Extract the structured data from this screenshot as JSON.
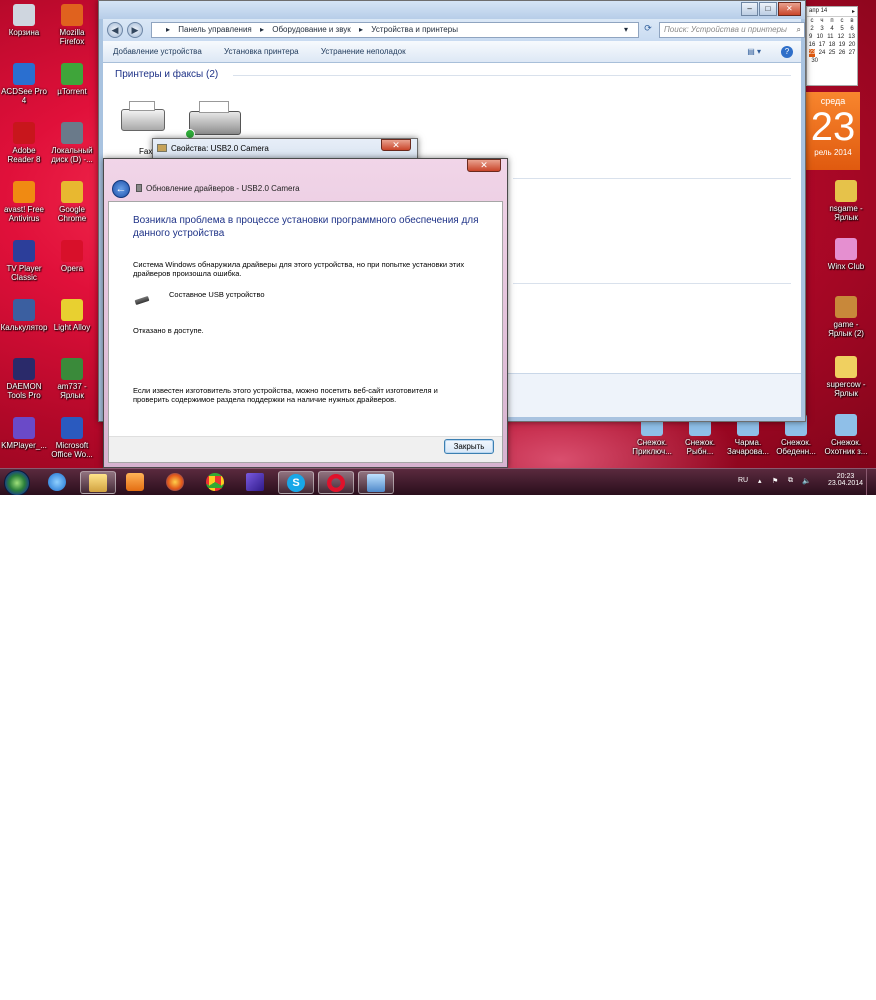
{
  "desktop_left": [
    {
      "label": "Корзина"
    },
    {
      "label": "Mozilla Firefox"
    },
    {
      "label": "ACDSee Pro 4"
    },
    {
      "label": "µTorrent"
    },
    {
      "label": "Adobe Reader 8"
    },
    {
      "label": "Локальный диск (D) -..."
    },
    {
      "label": "avast! Free Antivirus"
    },
    {
      "label": "Google Chrome"
    },
    {
      "label": "TV Player Classic"
    },
    {
      "label": "Opera"
    },
    {
      "label": "Калькулятор"
    },
    {
      "label": "Light Alloy"
    },
    {
      "label": "DAEMON Tools Pro"
    },
    {
      "label": "am737 - Ярлык"
    },
    {
      "label": "KMPlayer_..."
    },
    {
      "label": "Microsoft Office Wo..."
    }
  ],
  "desktop_right": [
    {
      "label": "nsgame - Ярлык"
    },
    {
      "label": "Winx Club"
    },
    {
      "label": "game - Ярлык (2)"
    },
    {
      "label": "supercow - Ярлык"
    },
    {
      "label": "Снежок. Охотник з..."
    }
  ],
  "desktop_bottom": [
    {
      "label": "Снежок. Приключ..."
    },
    {
      "label": "Снежок. Рыбн..."
    },
    {
      "label": "Чарма. Зачарова..."
    },
    {
      "label": "Снежок. Обеденн..."
    }
  ],
  "control_panel": {
    "breadcrumb": [
      "Панель управления",
      "Оборудование и звук",
      "Устройства и принтеры"
    ],
    "search_placeholder": "Поиск: Устройства и принтеры",
    "toolbar": [
      "Добавление устройства",
      "Установка принтера",
      "Устранение неполадок"
    ],
    "group_title": "Принтеры и факсы (2)",
    "fax_label": "Fax"
  },
  "properties_window": {
    "title": "Свойства: USB2.0 Camera"
  },
  "dialog": {
    "title": "Обновление драйверов - USB2.0 Camera",
    "heading": "Возникла проблема в процессе установки программного обеспечения для данного устройства",
    "message": "Система Windows обнаружила драйверы для этого устройства, но при попытке установки этих драйверов произошла ошибка.",
    "device": "Составное USB устройство",
    "error": "Отказано в доступе.",
    "hint": "Если известен изготовитель этого устройства, можно посетить веб-сайт изготовителя и проверить содержимое раздела поддержки на наличие нужных драйверов.",
    "close_label": "Закрыть"
  },
  "calendar": {
    "month": "апр 14",
    "days_header": [
      "с",
      "ч",
      "п",
      "с",
      "в"
    ],
    "rows": [
      [
        "2",
        "3",
        "4",
        "5",
        "6"
      ],
      [
        "9",
        "10",
        "11",
        "12",
        "13"
      ],
      [
        "16",
        "17",
        "18",
        "19",
        "20"
      ],
      [
        "23",
        "24",
        "25",
        "26",
        "27"
      ],
      [
        "30",
        "",
        "",
        "",
        ""
      ]
    ]
  },
  "clock_widget": {
    "weekday": "среда",
    "day": "23",
    "month_year": "рель 2014"
  },
  "tray": {
    "lang": "RU",
    "time": "20:23",
    "date": "23.04.2014"
  },
  "colors": {
    "accent_blue": "#1e3287",
    "desktop_red": "#d8103a",
    "taskbar": "#2a0e1c"
  }
}
